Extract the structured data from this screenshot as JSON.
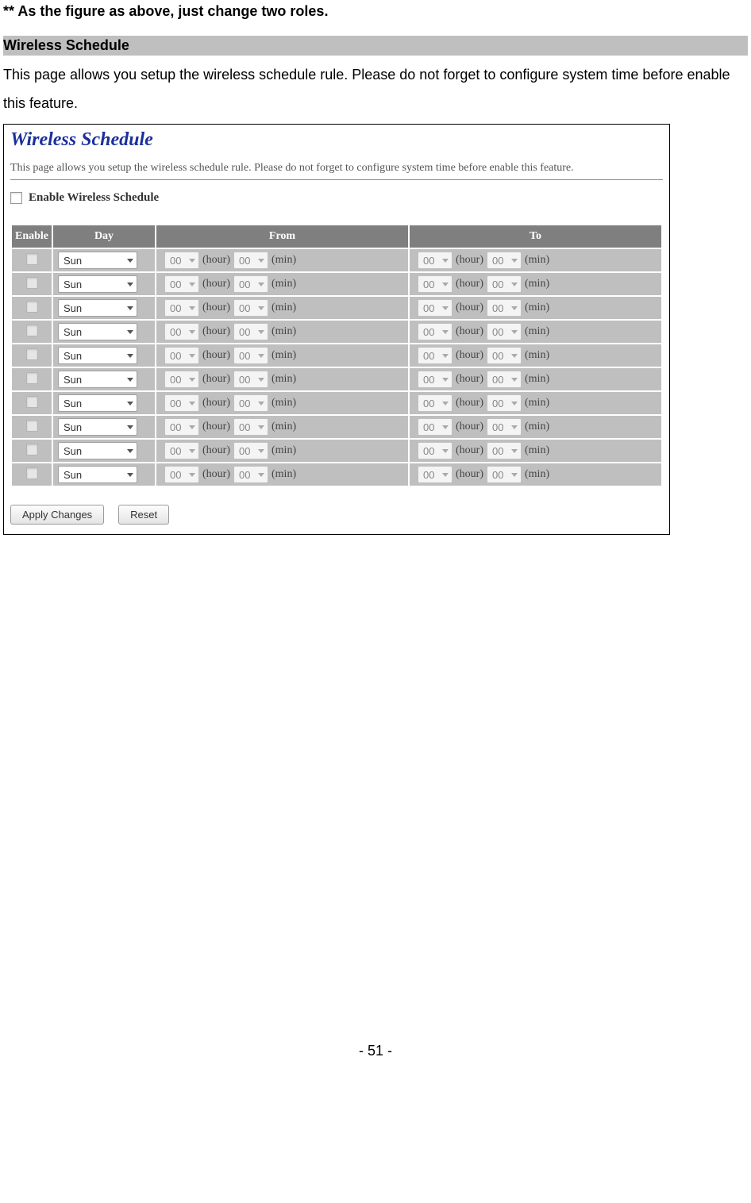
{
  "top_note": "** As the figure as above, just change two roles.",
  "section": {
    "header": "Wireless Schedule",
    "description": "This page allows you setup the wireless schedule rule. Please do not forget to configure system time before enable this feature."
  },
  "screenshot": {
    "title": "Wireless Schedule",
    "description": "This page allows you setup the wireless schedule rule. Please do not forget to configure system time before enable this feature.",
    "enable_label": "Enable Wireless Schedule",
    "table": {
      "headers": {
        "enable": "Enable",
        "day": "Day",
        "from": "From",
        "to": "To"
      },
      "unit_hour": "(hour)",
      "unit_min": "(min)",
      "rows": [
        {
          "day": "Sun",
          "from_h": "00",
          "from_m": "00",
          "to_h": "00",
          "to_m": "00"
        },
        {
          "day": "Sun",
          "from_h": "00",
          "from_m": "00",
          "to_h": "00",
          "to_m": "00"
        },
        {
          "day": "Sun",
          "from_h": "00",
          "from_m": "00",
          "to_h": "00",
          "to_m": "00"
        },
        {
          "day": "Sun",
          "from_h": "00",
          "from_m": "00",
          "to_h": "00",
          "to_m": "00"
        },
        {
          "day": "Sun",
          "from_h": "00",
          "from_m": "00",
          "to_h": "00",
          "to_m": "00"
        },
        {
          "day": "Sun",
          "from_h": "00",
          "from_m": "00",
          "to_h": "00",
          "to_m": "00"
        },
        {
          "day": "Sun",
          "from_h": "00",
          "from_m": "00",
          "to_h": "00",
          "to_m": "00"
        },
        {
          "day": "Sun",
          "from_h": "00",
          "from_m": "00",
          "to_h": "00",
          "to_m": "00"
        },
        {
          "day": "Sun",
          "from_h": "00",
          "from_m": "00",
          "to_h": "00",
          "to_m": "00"
        },
        {
          "day": "Sun",
          "from_h": "00",
          "from_m": "00",
          "to_h": "00",
          "to_m": "00"
        }
      ]
    },
    "buttons": {
      "apply": "Apply Changes",
      "reset": "Reset"
    }
  },
  "page_number": "- 51 -"
}
